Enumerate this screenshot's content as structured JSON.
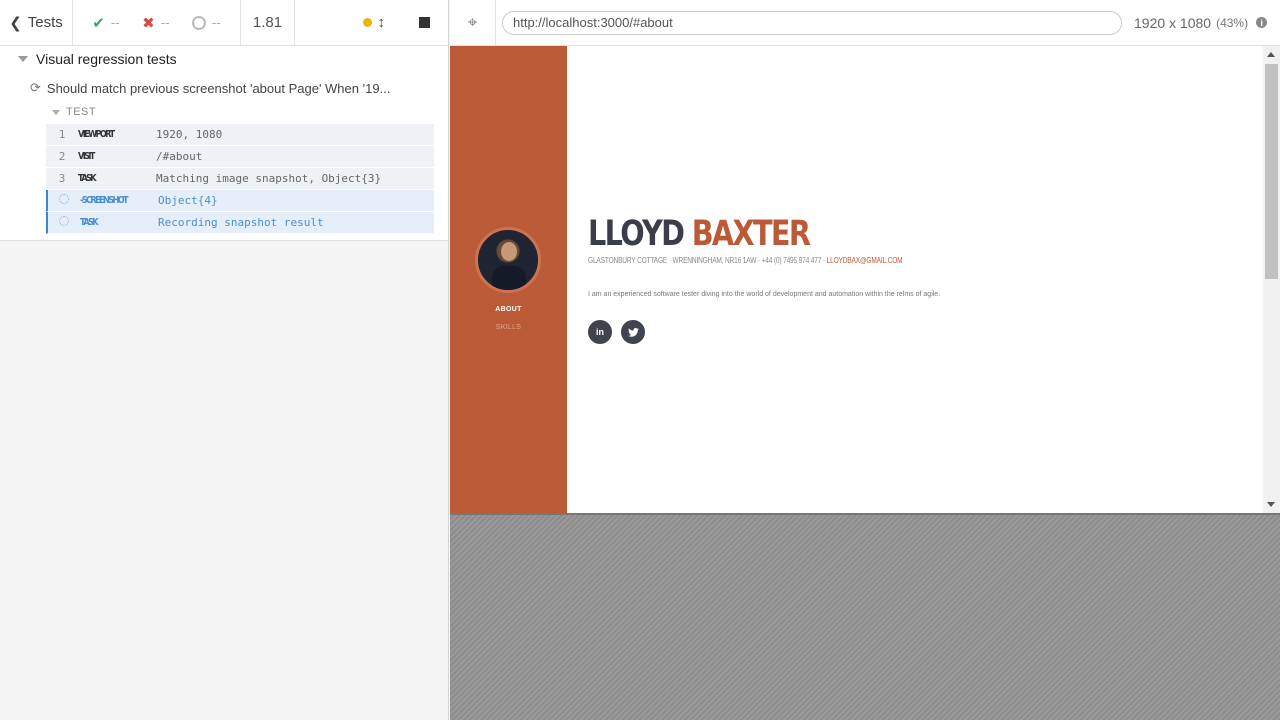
{
  "toolbar": {
    "tests_label": "Tests",
    "passed": "--",
    "failed": "--",
    "pending": "--",
    "duration": "1.81"
  },
  "tree": {
    "suite_title": "Visual regression tests",
    "test_title": "Should match previous screenshot 'about Page' When '19...",
    "hook_label": "TEST",
    "commands": [
      {
        "num": "1",
        "name": "VIEWPORT",
        "message": "1920, 1080",
        "state": "passed"
      },
      {
        "num": "2",
        "name": "VISIT",
        "message": "/#about",
        "state": "passed"
      },
      {
        "num": "3",
        "name": "TASK",
        "message": "Matching image snapshot, Object{3}",
        "state": "passed"
      },
      {
        "num": "",
        "name": "-SCREENSHOT",
        "message": "Object{4}",
        "state": "pending"
      },
      {
        "num": "",
        "name": "TASK",
        "message": "Recording snapshot result",
        "state": "pending"
      }
    ]
  },
  "preview": {
    "url": "http://localhost:3000/#about",
    "viewport": "1920 x 1080",
    "scale": "(43%)"
  },
  "site": {
    "nav_about": "ABOUT",
    "nav_skills": "SKILLS",
    "first_name": "LLOYD",
    "last_name": "BAXTER",
    "contact": "GLASTONBURY COTTAGE · WRENNINGHAM, NR16 1AW · +44 (0) 7495 974 477 ·",
    "email": "LLOYDBAX@GMAIL.COM",
    "bio": "I am an experienced software tester diving into the world of development and automation within the relms of agile.",
    "social_linkedin": "in",
    "social_twitter": "t"
  },
  "colors": {
    "accent": "#bb5a36",
    "pass": "#3aa36b",
    "fail": "#e0483f",
    "running": "#f0b400",
    "pending_cmd": "#4a8ed1"
  }
}
